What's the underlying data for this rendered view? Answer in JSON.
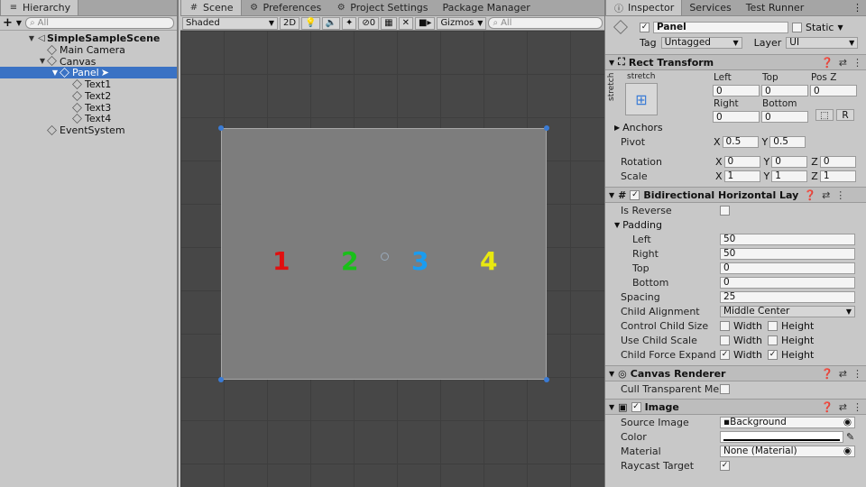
{
  "hierarchy": {
    "tab_label": "Hierarchy",
    "search_placeholder": "All",
    "add_label": "+",
    "items": [
      {
        "label": "SimpleSampleScene"
      },
      {
        "label": "Main Camera"
      },
      {
        "label": "Canvas"
      },
      {
        "label": "Panel"
      },
      {
        "label": "Text1"
      },
      {
        "label": "Text2"
      },
      {
        "label": "Text3"
      },
      {
        "label": "Text4"
      },
      {
        "label": "EventSystem"
      }
    ]
  },
  "scene": {
    "tabs": [
      {
        "label": "Scene"
      },
      {
        "label": "Preferences"
      },
      {
        "label": "Project Settings"
      },
      {
        "label": "Package Manager"
      }
    ],
    "toolbar": {
      "shading": "Shaded",
      "mode_2d": "2D",
      "hidden_count": "0",
      "gizmos": "Gizmos",
      "search_placeholder": "All"
    },
    "numbers": [
      {
        "text": "1",
        "color": "#e01010"
      },
      {
        "text": "2",
        "color": "#18c018"
      },
      {
        "text": "3",
        "color": "#1a9cf0"
      },
      {
        "text": "4",
        "color": "#e8e810"
      }
    ]
  },
  "inspector": {
    "tabs": [
      {
        "label": "Inspector"
      },
      {
        "label": "Services"
      },
      {
        "label": "Test Runner"
      }
    ],
    "object_name": "Panel",
    "static_label": "Static",
    "tag_label": "Tag",
    "tag_value": "Untagged",
    "layer_label": "Layer",
    "layer_value": "UI",
    "rect_transform": {
      "title": "Rect Transform",
      "anchor_preset_top": "stretch",
      "anchor_preset_side": "stretch",
      "left_label": "Left",
      "left_value": "0",
      "top_label": "Top",
      "top_value": "0",
      "posz_label": "Pos Z",
      "posz_value": "0",
      "right_label": "Right",
      "right_value": "0",
      "bottom_label": "Bottom",
      "bottom_value": "0",
      "r_button": "R",
      "anchors_label": "Anchors",
      "pivot_label": "Pivot",
      "pivot_x": "0.5",
      "pivot_y": "0.5",
      "rotation_label": "Rotation",
      "rotation_x": "0",
      "rotation_y": "0",
      "rotation_z": "0",
      "scale_label": "Scale",
      "scale_x": "1",
      "scale_y": "1",
      "scale_z": "1",
      "x_label": "X",
      "y_label": "Y",
      "z_label": "Z"
    },
    "layout": {
      "title": "Bidirectional Horizontal Layout",
      "is_reverse_label": "Is Reverse",
      "padding_label": "Padding",
      "left_label": "Left",
      "left_value": "50",
      "right_label": "Right",
      "right_value": "50",
      "top_label": "Top",
      "top_value": "0",
      "bottom_label": "Bottom",
      "bottom_value": "0",
      "spacing_label": "Spacing",
      "spacing_value": "25",
      "child_alignment_label": "Child Alignment",
      "child_alignment_value": "Middle Center",
      "control_child_size_label": "Control Child Size",
      "use_child_scale_label": "Use Child Scale",
      "child_force_expand_label": "Child Force Expand",
      "width_label": "Width",
      "height_label": "Height"
    },
    "canvas_renderer": {
      "title": "Canvas Renderer",
      "cull_label": "Cull Transparent Me"
    },
    "image": {
      "title": "Image",
      "source_image_label": "Source Image",
      "source_image_value": "Background",
      "color_label": "Color",
      "material_label": "Material",
      "material_value": "None (Material)",
      "raycast_label": "Raycast Target"
    }
  }
}
